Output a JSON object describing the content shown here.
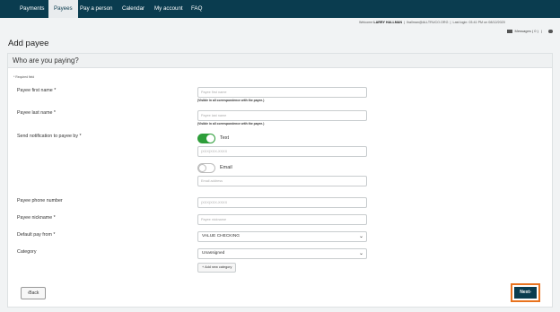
{
  "nav": {
    "items": [
      "Payments",
      "Payees",
      "Pay a person",
      "Calendar",
      "My account",
      "FAQ"
    ],
    "active": "Payees"
  },
  "userbar": {
    "welcome_prefix": "Welcome",
    "user_name": "LARRY HALLMAN",
    "email": "lhallman@ALLTRUCO.ORG",
    "last_login": "Last login: 03:41 PM on 08/12/2020",
    "messages": "Messages ( 0 )"
  },
  "page": {
    "title": "Add payee",
    "section_heading": "Who are you paying?",
    "required_note": "* Required field"
  },
  "form": {
    "first_name": {
      "label": "Payee first name *",
      "placeholder": "Payee first name",
      "hint": "(Visible in all correspondence with the payee.)"
    },
    "last_name": {
      "label": "Payee last name *",
      "placeholder": "Payee last name",
      "hint": "(Visible in all correspondence with the payee.)"
    },
    "notification": {
      "label": "Send notification to payee by *",
      "text_toggle_label": "Text",
      "text_toggle_on": true,
      "phone_placeholder": "(XXX)XXX-XXXX",
      "email_toggle_label": "Email",
      "email_toggle_on": false,
      "email_placeholder": "Email address"
    },
    "phone": {
      "label": "Payee phone number",
      "placeholder": "(XXX)XXX-XXXX"
    },
    "nickname": {
      "label": "Payee nickname *",
      "placeholder": "Payee nickname"
    },
    "default_pay_from": {
      "label": "Default pay from *",
      "value": "VALUE CHECKING"
    },
    "category": {
      "label": "Category",
      "value": "Unassigned",
      "add_button": "+ Add new category"
    }
  },
  "actions": {
    "back": "Back",
    "next": "Next"
  },
  "colors": {
    "nav_bg": "#0a3c4f",
    "toggle_on": "#2e9e3a",
    "highlight": "#e8731f"
  }
}
